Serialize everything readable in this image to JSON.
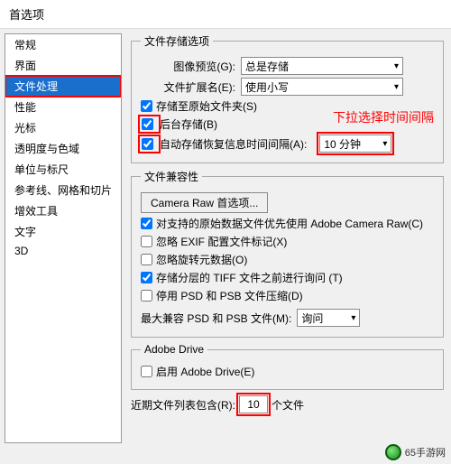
{
  "window": {
    "title": "首选项"
  },
  "sidebar": {
    "items": [
      {
        "label": "常规"
      },
      {
        "label": "界面"
      },
      {
        "label": "文件处理"
      },
      {
        "label": "性能"
      },
      {
        "label": "光标"
      },
      {
        "label": "透明度与色域"
      },
      {
        "label": "单位与标尺"
      },
      {
        "label": "参考线、网格和切片"
      },
      {
        "label": "增效工具"
      },
      {
        "label": "文字"
      },
      {
        "label": "3D"
      }
    ],
    "selected_index": 2
  },
  "storage_section": {
    "legend": "文件存储选项",
    "image_preview": {
      "label": "图像预览(G):",
      "value": "总是存储"
    },
    "file_extension": {
      "label": "文件扩展名(E):",
      "value": "使用小写"
    },
    "save_original": {
      "label": "存储至原始文件夹(S)",
      "checked": true
    },
    "background_save": {
      "label": "后台存储(B)",
      "checked": true
    },
    "auto_save": {
      "label": "自动存储恢复信息时间间隔(A):",
      "checked": true,
      "value": "10 分钟"
    },
    "annotation": "下拉选择时间间隔"
  },
  "compat_section": {
    "legend": "文件兼容性",
    "camera_raw_btn": "Camera Raw 首选项...",
    "prefer_raw": {
      "label": "对支持的原始数据文件优先使用 Adobe Camera Raw(C)",
      "checked": true
    },
    "ignore_exif": {
      "label": "忽略 EXIF 配置文件标记(X)",
      "checked": false
    },
    "ignore_rotation": {
      "label": "忽略旋转元数据(O)",
      "checked": false
    },
    "ask_tiff": {
      "label": "存储分层的 TIFF 文件之前进行询问 (T)",
      "checked": true
    },
    "disable_psd": {
      "label": "停用 PSD 和 PSB 文件压缩(D)",
      "checked": false
    },
    "max_compat": {
      "label": "最大兼容 PSD 和 PSB 文件(M):",
      "value": "询问"
    }
  },
  "drive_section": {
    "legend": "Adobe Drive",
    "enable": {
      "label": "启用 Adobe Drive(E)",
      "checked": false
    }
  },
  "recent": {
    "prefix": "近期文件列表包含(R):",
    "value": "10",
    "suffix": "个文件"
  },
  "footer": {
    "text": "65手游网"
  }
}
